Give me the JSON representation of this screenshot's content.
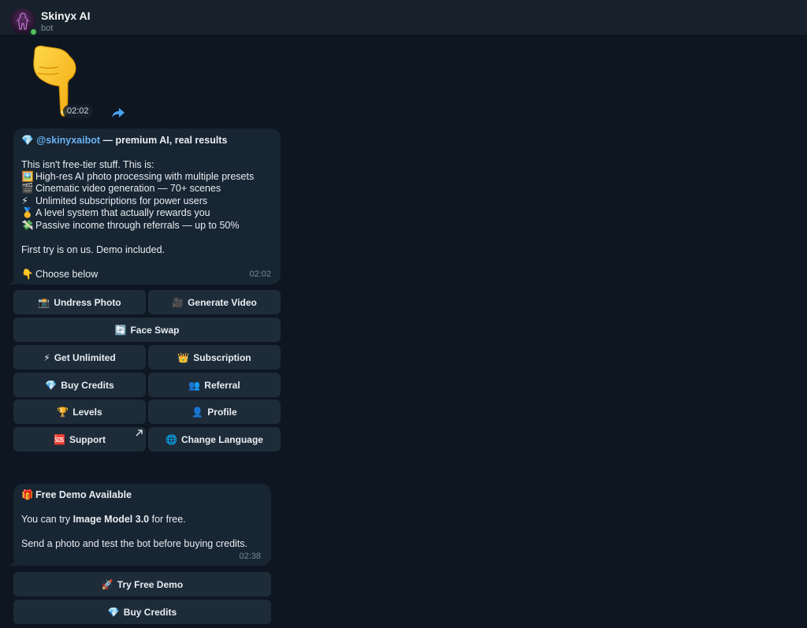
{
  "header": {
    "title": "Skinyx AI",
    "subtitle": "bot"
  },
  "sticker": {
    "time": "02:02"
  },
  "message1": {
    "title_emoji": "💎",
    "mention": "@skinyxaibot",
    "title_rest": " — premium AI, real results",
    "intro": "This isn't free-tier stuff. This is:",
    "features": [
      {
        "icon": "🖼️",
        "text": "High-res AI photo processing with multiple presets"
      },
      {
        "icon": "🎬",
        "text": "Cinematic video generation — 70+ scenes"
      },
      {
        "icon": "⚡",
        "text": "Unlimited subscriptions for power users"
      },
      {
        "icon": "🥇",
        "text": "A level system that actually rewards you"
      },
      {
        "icon": "💸",
        "text": "Passive income through referrals — up to 50%"
      }
    ],
    "first_try": "First try is on us. Demo included.",
    "choose_icon": "👇",
    "choose_text": "Choose below",
    "time": "02:02"
  },
  "keyboard1": [
    {
      "icon": "📸",
      "label": "Undress Photo"
    },
    {
      "icon": "🎥",
      "label": "Generate Video"
    },
    {
      "icon": "🔄",
      "label": "Face Swap"
    },
    {
      "icon": "⚡",
      "label": "Get Unlimited"
    },
    {
      "icon": "👑",
      "label": "Subscription"
    },
    {
      "icon": "💎",
      "label": "Buy Credits"
    },
    {
      "icon": "👥",
      "label": "Referral"
    },
    {
      "icon": "🏆",
      "label": "Levels"
    },
    {
      "icon": "👤",
      "label": "Profile"
    },
    {
      "icon": "🆘",
      "label": "Support"
    },
    {
      "icon": "🌐",
      "label": "Change Language"
    }
  ],
  "message2": {
    "title_icon": "🎁",
    "title": "Free Demo Available",
    "try_prefix": "You can try ",
    "try_model": "Image Model 3.0",
    "try_suffix": " for free.",
    "send_text": "Send a photo and test the bot before buying credits.",
    "time": "02:38"
  },
  "keyboard2": [
    {
      "icon": "🚀",
      "label": "Try Free Demo"
    },
    {
      "icon": "💎",
      "label": "Buy Credits"
    }
  ]
}
